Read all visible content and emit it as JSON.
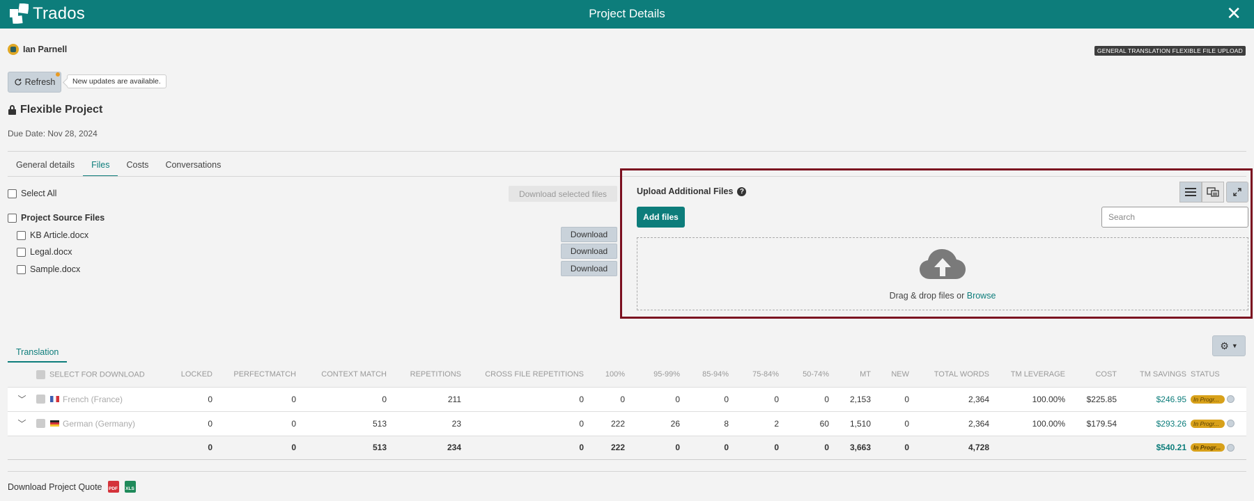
{
  "app": {
    "brand": "Trados",
    "title": "Project Details",
    "accent": "#0d7d7b"
  },
  "user": {
    "name": "Ian Parnell"
  },
  "project_type": "GENERAL TRANSLATION FLEXIBLE FILE UPLOAD",
  "refresh": {
    "label": "Refresh",
    "tooltip": "New updates are available."
  },
  "project": {
    "name": "Flexible Project",
    "due_date": "Due Date: Nov 28, 2024"
  },
  "tabs": [
    "General details",
    "Files",
    "Costs",
    "Conversations"
  ],
  "active_tab": "Files",
  "files": {
    "select_all": "Select All",
    "download_selected": "Download selected files",
    "group_label": "Project Source Files",
    "download_label": "Download",
    "items": [
      "KB Article.docx",
      "Legal.docx",
      "Sample.docx"
    ]
  },
  "upload": {
    "title": "Upload Additional Files",
    "add_files": "Add files",
    "search_placeholder": "Search",
    "drop_text": "Drag & drop files or ",
    "browse": "Browse"
  },
  "translation": {
    "tab": "Translation",
    "columns": [
      "SELECT FOR DOWNLOAD",
      "LOCKED",
      "PERFECTMATCH",
      "CONTEXT MATCH",
      "REPETITIONS",
      "CROSS FILE REPETITIONS",
      "100%",
      "95-99%",
      "85-94%",
      "75-84%",
      "50-74%",
      "MT",
      "NEW",
      "TOTAL WORDS",
      "TM LEVERAGE",
      "COST",
      "TM SAVINGS",
      "STATUS"
    ],
    "rows": [
      {
        "language": "French (France)",
        "locked": "0",
        "perfect": "0",
        "context": "0",
        "repetitions": "211",
        "cross": "0",
        "p100": "0",
        "p95": "0",
        "p85": "0",
        "p75": "0",
        "p50": "0",
        "mt": "2,153",
        "new": "0",
        "total": "2,364",
        "leverage": "100.00%",
        "cost": "$225.85",
        "savings": "$246.95",
        "status": "In Progr..."
      },
      {
        "language": "German (Germany)",
        "locked": "0",
        "perfect": "0",
        "context": "513",
        "repetitions": "23",
        "cross": "0",
        "p100": "222",
        "p95": "26",
        "p85": "8",
        "p75": "2",
        "p50": "60",
        "mt": "1,510",
        "new": "0",
        "total": "2,364",
        "leverage": "100.00%",
        "cost": "$179.54",
        "savings": "$293.26",
        "status": "In Progr..."
      }
    ],
    "totals": {
      "locked": "0",
      "perfect": "0",
      "context": "513",
      "repetitions": "234",
      "cross": "0",
      "p100": "222",
      "p95": "0",
      "p85": "0",
      "p75": "0",
      "p50": "0",
      "mt": "3,663",
      "new": "0",
      "total": "4,728",
      "savings": "$540.21",
      "status": "In Progr..."
    }
  },
  "quote": {
    "label": "Download Project Quote",
    "pdf": "PDF",
    "xls": "XLS"
  }
}
